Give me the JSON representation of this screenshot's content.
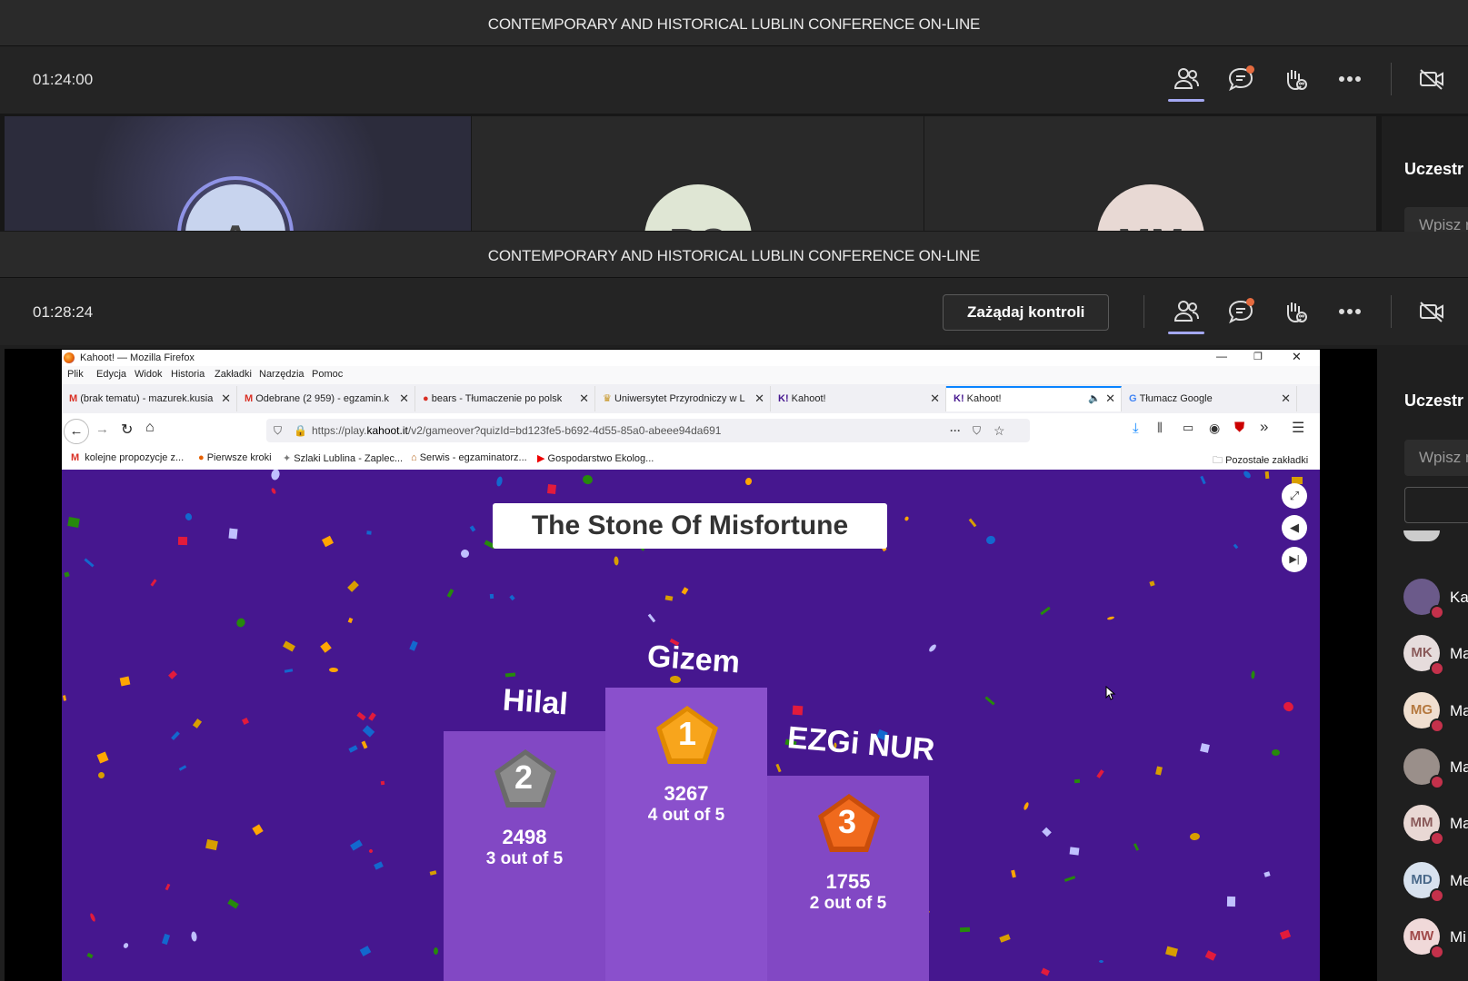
{
  "meeting": {
    "title_top": "CONTEMPORARY AND HISTORICAL LUBLIN CONFERENCE ON-LINE",
    "timer_top": "01:24:00",
    "title_bottom": "CONTEMPORARY AND HISTORICAL LUBLIN CONFERENCE ON-LINE",
    "timer_bottom": "01:28:24",
    "request_control": "Zażądaj kontroli",
    "tiles": [
      {
        "initials": "A",
        "color": "#c8d4ee"
      },
      {
        "initials": "BC",
        "color": "#dfe6d4"
      },
      {
        "initials": "MM",
        "color": "#e8d9d4"
      }
    ],
    "icons": [
      "people-icon",
      "chat-icon",
      "raise-hand-icon",
      "more-icon",
      "camera-off-icon"
    ]
  },
  "sidebar": {
    "title_top": "Uczestr",
    "search_top": "Wpisz r",
    "title": "Uczestr",
    "search": "Wpisz n",
    "participants": [
      {
        "initials": "",
        "name": "Ka",
        "color": "#6b5a8a"
      },
      {
        "initials": "MK",
        "name": "Ma",
        "color": "#e6dcdc"
      },
      {
        "initials": "MG",
        "name": "Ma",
        "color": "#f0dfd0"
      },
      {
        "initials": "",
        "name": "Ma",
        "color": "#9a8f8a"
      },
      {
        "initials": "MM",
        "name": "Ma",
        "color": "#e9d8d4"
      },
      {
        "initials": "MD",
        "name": "Me",
        "color": "#d8e2ee"
      },
      {
        "initials": "MW",
        "name": "Mi",
        "color": "#f0d9d9"
      }
    ]
  },
  "browser": {
    "window_title": "Kahoot! — Mozilla Firefox",
    "menu": [
      "Plik",
      "Edycja",
      "Widok",
      "Historia",
      "Zakładki",
      "Narzędzia",
      "Pomoc"
    ],
    "tabs": [
      {
        "label": "(brak tematu) - mazurek.kusia",
        "active": false
      },
      {
        "label": "Odebrane (2 959) - egzamin.k",
        "active": false
      },
      {
        "label": "bears - Tłumaczenie po polsk",
        "active": false
      },
      {
        "label": "Uniwersytet Przyrodniczy w L",
        "active": false
      },
      {
        "label": "Kahoot!",
        "active": false
      },
      {
        "label": "Kahoot!",
        "active": true
      },
      {
        "label": "Tłumacz Google",
        "active": false
      }
    ],
    "url_prefix": "https://play.",
    "url_domain": "kahoot.it",
    "url_rest": "/v2/gameover?quizId=bd123fe5-b692-4d55-85a0-abeee94da691",
    "bookmarks": [
      "kolejne propozycje z...",
      "Pierwsze kroki",
      "Szlaki Lublina - Zaplec...",
      "Serwis - egzaminatorz...",
      "Gospodarstwo Ekolog..."
    ],
    "other_bookmarks": "Pozostałe zakładki"
  },
  "kahoot": {
    "quiz_title": "The Stone Of Misfortune",
    "podium": [
      {
        "place": "1",
        "name": "Gizem",
        "score": "3267",
        "correct": "4 out of 5",
        "color": "#f8a51c"
      },
      {
        "place": "2",
        "name": "Hilal",
        "score": "2498",
        "correct": "3 out of 5",
        "color": "#8c8c8c"
      },
      {
        "place": "3",
        "name": "EZGi NUR",
        "score": "1755",
        "correct": "2 out of 5",
        "color": "#f06a1d"
      }
    ]
  }
}
